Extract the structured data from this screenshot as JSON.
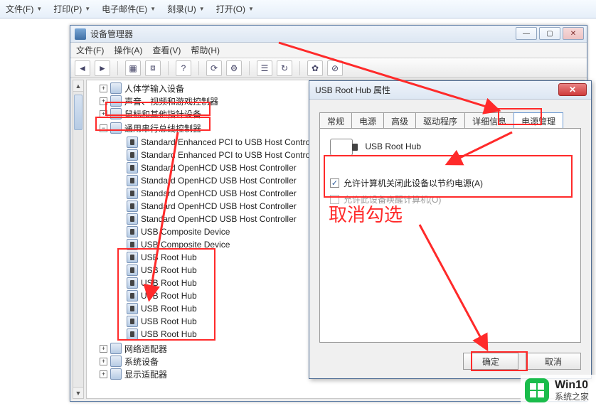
{
  "ie_menu": {
    "file": "文件(F)",
    "print": "打印(P)",
    "email": "电子邮件(E)",
    "burn": "刻录(U)",
    "open": "打开(O)"
  },
  "devmgr": {
    "title": "设备管理器",
    "menu": {
      "file": "文件(F)",
      "action": "操作(A)",
      "view": "查看(V)",
      "help": "帮助(H)"
    },
    "tree": {
      "hid": "人体学输入设备",
      "sound": "声音、视频和游戏控制器",
      "mouse": "鼠标和其他指针设备",
      "usb_ctrl": "通用串行总线控制器",
      "ctrl1": "Standard Enhanced PCI to USB Host Controlle",
      "ctrl2": "Standard Enhanced PCI to USB Host Controlle",
      "ctrl3": "Standard OpenHCD USB Host Controller",
      "ctrl4": "Standard OpenHCD USB Host Controller",
      "ctrl5": "Standard OpenHCD USB Host Controller",
      "ctrl6": "Standard OpenHCD USB Host Controller",
      "ctrl7": "Standard OpenHCD USB Host Controller",
      "comp1": "USB Composite Device",
      "comp2": "USB Composite Device",
      "hub1": "USB Root Hub",
      "hub2": "USB Root Hub",
      "hub3": "USB Root Hub",
      "hub4": "USB Root Hub",
      "hub5": "USB Root Hub",
      "hub6": "USB Root Hub",
      "hub7": "USB Root Hub",
      "network": "网络适配器",
      "system": "系统设备",
      "display": "显示适配器"
    }
  },
  "props": {
    "title": "USB Root Hub 属性",
    "tabs": {
      "general": "常规",
      "power": "电源",
      "advanced": "高级",
      "driver": "驱动程序",
      "details": "详细信息",
      "powermgmt": "电源管理"
    },
    "device_name": "USB Root Hub",
    "chk_shutdown": "允许计算机关闭此设备以节约电源(A)",
    "chk_wake": "允许此设备唤醒计算机(O)",
    "ok": "确定",
    "cancel": "取消"
  },
  "annotation": {
    "uncheck": "取消勾选"
  },
  "watermark": {
    "line1": "Win10",
    "line2": "系统之家"
  }
}
